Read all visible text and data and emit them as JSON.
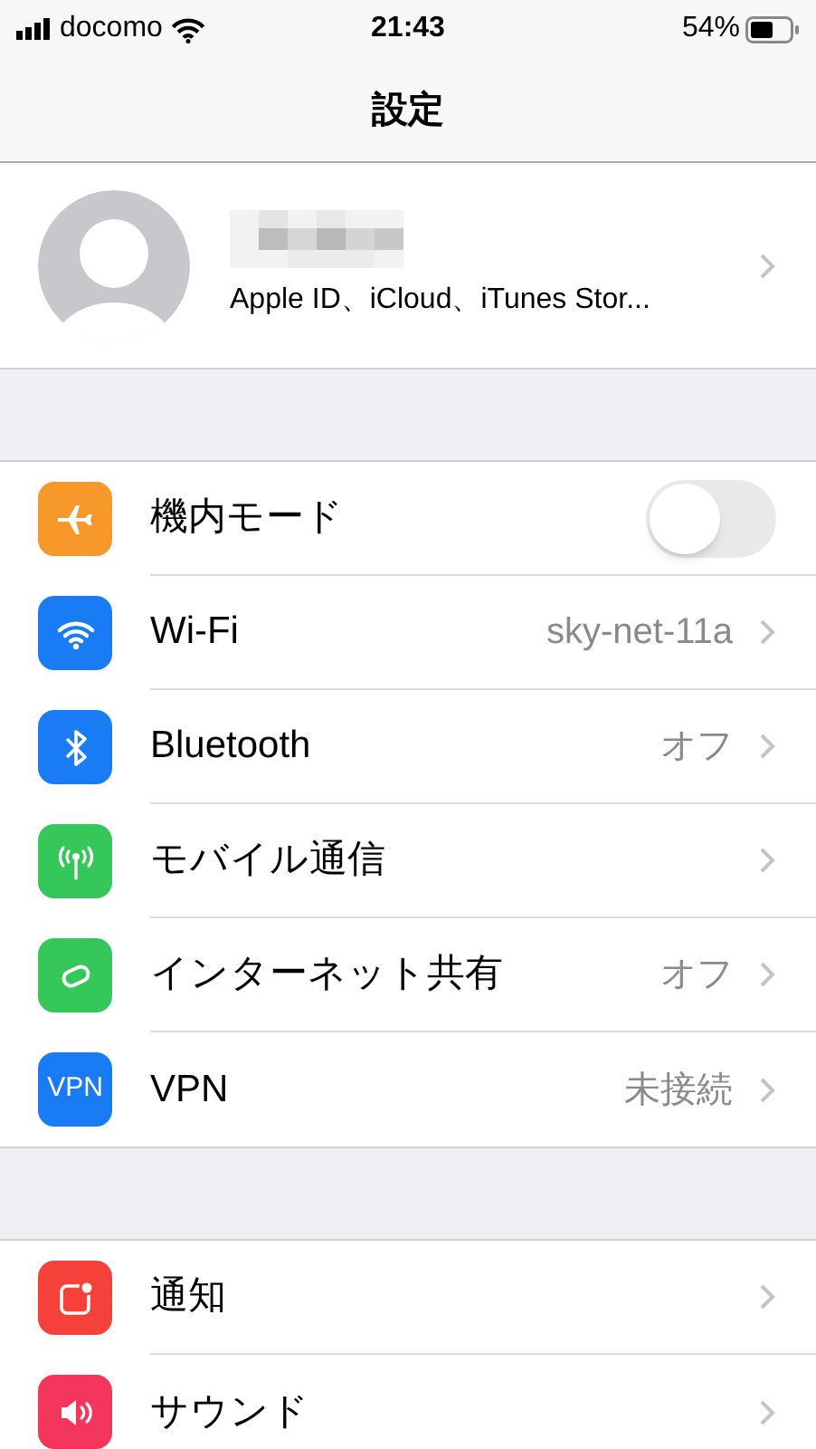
{
  "status_bar": {
    "carrier": "docomo",
    "time": "21:43",
    "battery": "54%"
  },
  "nav": {
    "title": "設定"
  },
  "profile": {
    "subtitle": "Apple ID、iCloud、iTunes Stor..."
  },
  "groups": [
    {
      "rows": [
        {
          "kind": "toggle",
          "label": "機内モード",
          "color": "#f7982b",
          "on": false
        },
        {
          "kind": "link",
          "label": "Wi-Fi",
          "color": "#1a7cf5",
          "value": "sky-net-11a"
        },
        {
          "kind": "link",
          "label": "Bluetooth",
          "color": "#1a7cf5",
          "value": "オフ"
        },
        {
          "kind": "link",
          "label": "モバイル通信",
          "color": "#35c759"
        },
        {
          "kind": "link",
          "label": "インターネット共有",
          "color": "#35c759",
          "value": "オフ"
        },
        {
          "kind": "link",
          "label": "VPN",
          "color": "#1a7cf5",
          "value": "未接続",
          "icon_text": "VPN"
        }
      ]
    },
    {
      "rows": [
        {
          "kind": "link",
          "label": "通知",
          "color": "#f5413a"
        },
        {
          "kind": "link",
          "label": "サウンド",
          "color": "#f5365c"
        }
      ]
    }
  ]
}
